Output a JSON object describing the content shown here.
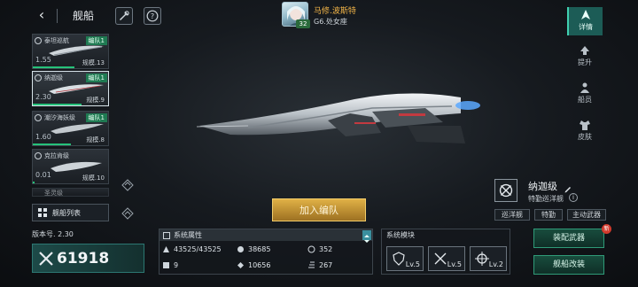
{
  "header": {
    "back_label": "‹",
    "title": "舰船"
  },
  "commander": {
    "level": "32",
    "name": "马修.波斯特",
    "subtitle": "G6.处女座"
  },
  "fleet": {
    "cards": [
      {
        "name": "泰坦巡航",
        "badge": "编队1",
        "power": "1.55",
        "scale": "规模.13"
      },
      {
        "name": "纳迦级",
        "badge": "编队1",
        "power": "2.30",
        "scale": "规模.9"
      },
      {
        "name": "潮汐海妖级",
        "badge": "编队1",
        "power": "1.60",
        "scale": "规模.8"
      },
      {
        "name": "克拉肯级",
        "badge": "",
        "power": "0.01",
        "scale": "规模.10"
      },
      {
        "name": "圣灵级",
        "badge": "",
        "power": "",
        "scale": ""
      }
    ],
    "list_button": "舰船列表"
  },
  "side_tabs": [
    {
      "label": "详情",
      "icon": "ship-detail-icon"
    },
    {
      "label": "提升",
      "icon": "upgrade-icon"
    },
    {
      "label": "船员",
      "icon": "crew-icon"
    },
    {
      "label": "皮肤",
      "icon": "skin-icon"
    }
  ],
  "ship": {
    "name": "纳迦级",
    "class": "特勤巡洋舰",
    "tags": [
      "巡洋舰",
      "特勤",
      "主动武器"
    ]
  },
  "join_button": "加入编队",
  "version": "版本号. 2.30",
  "power": "61918",
  "attributes": {
    "title": "系统属性",
    "items": [
      {
        "icon": "hull-icon",
        "value": "43525/43525"
      },
      {
        "icon": "armor-icon",
        "value": "38685"
      },
      {
        "icon": "shield-icon",
        "value": "352"
      },
      {
        "icon": "cannon-icon",
        "value": "9"
      },
      {
        "icon": "energy-icon",
        "value": "10656"
      },
      {
        "icon": "speed-icon",
        "value": "267"
      }
    ]
  },
  "modules": {
    "title": "系统模块",
    "slots": [
      {
        "icon": "shield-module-icon",
        "level": "Lv.5"
      },
      {
        "icon": "crossed-guns-icon",
        "level": "Lv.5"
      },
      {
        "icon": "target-icon",
        "level": "Lv.2"
      }
    ]
  },
  "actions": {
    "equip": "装配武器",
    "refit": "舰船改装",
    "new_badge": "新"
  },
  "colors": {
    "accent": "#26c27a",
    "gold": "#e0b146",
    "tab_active": "#1c5c56"
  }
}
